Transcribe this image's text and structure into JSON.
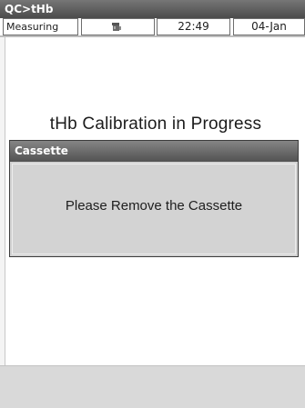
{
  "title_bar": {
    "title": "QC>tHb"
  },
  "status_bar": {
    "mode": "Measuring",
    "icon": "drop-bucket-icon",
    "time": "22:49",
    "date": "04-Jan"
  },
  "main": {
    "heading": "tHb Calibration in Progress"
  },
  "dialog": {
    "title": "Cassette",
    "message": "Please Remove the Cassette"
  },
  "colors": {
    "title_bar": "#5a5a5a",
    "dialog_header": "#666666",
    "dialog_body": "#d3d3d3",
    "bottom_bar": "#d9d9d9"
  }
}
